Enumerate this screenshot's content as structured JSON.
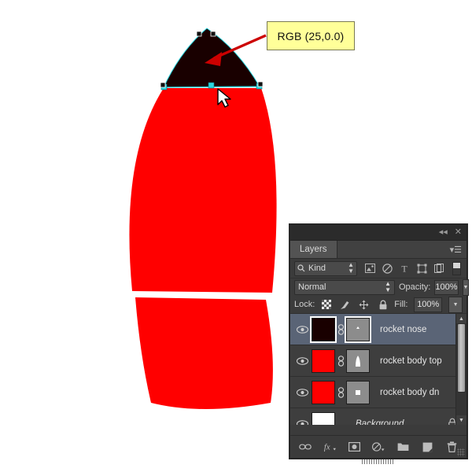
{
  "callout": {
    "label": "RGB (25,0.0)",
    "box_color": "#ffff99",
    "arrow_color": "#cc0000"
  },
  "artwork": {
    "nose_color": "#190000",
    "body_color": "#ff0000",
    "background_color": "#ffffff",
    "path_anchor_color": "#29d6e0",
    "path_handle_color": "#000000"
  },
  "panel": {
    "titlebar": {
      "collapse_icon": "collapse-to-icons",
      "close_icon": "close"
    },
    "tab_label": "Layers",
    "menu_icon": "panel-menu",
    "filter": {
      "kind_label": "Kind",
      "search_icon": "search-icon",
      "icons": [
        "pixel-filter-icon",
        "adjustment-filter-icon",
        "type-filter-icon",
        "shape-filter-icon",
        "smart-object-filter-icon"
      ],
      "toggle_icon": "filter-toggle"
    },
    "blend": {
      "mode": "Normal",
      "opacity_label": "Opacity:",
      "opacity_value": "100%"
    },
    "lock": {
      "label": "Lock:",
      "icons": [
        "lock-transparency-icon",
        "lock-image-icon",
        "lock-position-icon",
        "lock-all-icon"
      ],
      "fill_label": "Fill:",
      "fill_value": "100%"
    },
    "layers": [
      {
        "name": "rocket nose",
        "thumb_color": "#190000",
        "mask_color": "#8c8c8c",
        "mask_mark": "small-triangle",
        "selected": true,
        "visible": true,
        "linked": true,
        "locked": false,
        "italic": false
      },
      {
        "name": "rocket body top",
        "thumb_color": "#ff0000",
        "mask_color": "#8c8c8c",
        "mask_mark": "bullet-shape",
        "selected": false,
        "visible": true,
        "linked": true,
        "locked": false,
        "italic": false
      },
      {
        "name": "rocket body dn",
        "thumb_color": "#ff0000",
        "mask_color": "#8c8c8c",
        "mask_mark": "square",
        "selected": false,
        "visible": true,
        "linked": true,
        "locked": false,
        "italic": false
      },
      {
        "name": "Background",
        "thumb_color": "#ffffff",
        "mask_color": null,
        "mask_mark": null,
        "selected": false,
        "visible": true,
        "linked": false,
        "locked": true,
        "italic": true
      }
    ],
    "bottom_icons": [
      "link-layers-icon",
      "layer-style-icon",
      "layer-mask-icon",
      "adjustment-layer-icon",
      "new-group-icon",
      "new-layer-icon",
      "delete-layer-icon"
    ],
    "scrollbar": {
      "up_arrow": "scroll-up",
      "down_arrow": "scroll-down"
    }
  }
}
